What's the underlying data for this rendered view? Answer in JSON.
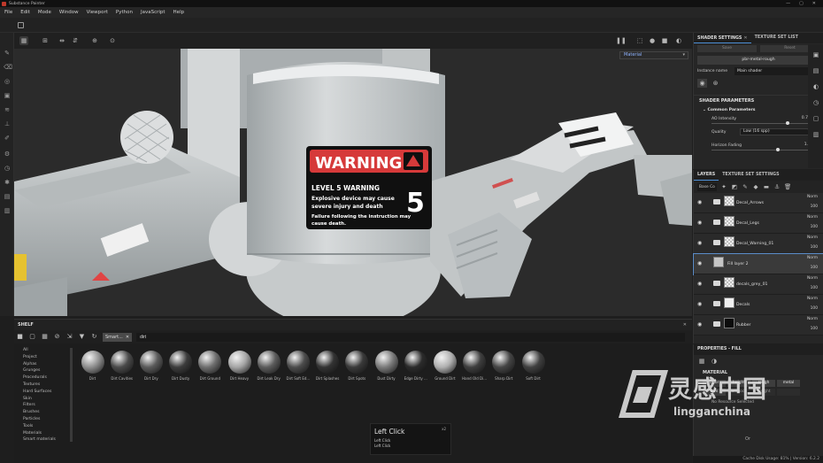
{
  "app": {
    "title": "Substance Painter",
    "window_controls": [
      "—",
      "▢",
      "✕"
    ]
  },
  "menu": [
    "File",
    "Edit",
    "Mode",
    "Window",
    "Viewport",
    "Python",
    "JavaScript",
    "Help"
  ],
  "viewport": {
    "material_select": "Material",
    "warning": {
      "header": "WARNING",
      "level": "LEVEL 5 WARNING",
      "line1": "Explosive device may cause",
      "line2": "severe injury and death",
      "line3": "Failure following the instruction may",
      "line4": "cause death.",
      "number": "5"
    }
  },
  "shelf": {
    "title": "SHELF",
    "tag_label": "Smart...",
    "tag_close": "✕",
    "search_value": "dirt",
    "categories": [
      "All",
      "Project",
      "Alphas",
      "Grunges",
      "Procedurals",
      "Textures",
      "Hard Surfaces",
      "Skin",
      "Filters",
      "Brushes",
      "Particles",
      "Tools",
      "Materials",
      "Smart materials"
    ],
    "items": [
      {
        "label": "Dirt",
        "color": "#8e8e8e"
      },
      {
        "label": "Dirt Cavities",
        "color": "#4a4a4a"
      },
      {
        "label": "Dirt Dry",
        "color": "#5a5a5a"
      },
      {
        "label": "Dirt Dusty",
        "color": "#3c3c3c"
      },
      {
        "label": "Dirt Ground",
        "color": "#6e6e6e"
      },
      {
        "label": "Dirt Heavy",
        "color": "#a5a5a5"
      },
      {
        "label": "Dirt Leak Dry",
        "color": "#5c5c5c"
      },
      {
        "label": "Dirt Soft Ed...",
        "color": "#4c4c4c"
      },
      {
        "label": "Dirt Splashes",
        "color": "#333333"
      },
      {
        "label": "Dirt Spots",
        "color": "#3a3a3a"
      },
      {
        "label": "Dust Dirty",
        "color": "#7a7a7a"
      },
      {
        "label": "Edge Dirty ...",
        "color": "#2b2b2b"
      },
      {
        "label": "Ground Dirt",
        "color": "#b0b0b0"
      },
      {
        "label": "Hand Old Di...",
        "color": "#3e3e3e"
      },
      {
        "label": "Sharp Dirt",
        "color": "#454545"
      },
      {
        "label": "Soft Dirt",
        "color": "#404040"
      }
    ]
  },
  "tooltip": {
    "title": "Left Click",
    "badge": "x2",
    "line1": "Left Click",
    "line2": "Left Click"
  },
  "shader_panel": {
    "tab_active": "SHADER SETTINGS",
    "tab_other": "TEXTURE SET LIST",
    "btn_left": "Save",
    "btn_right": "Reset",
    "shader_name": "pbr-metal-rough",
    "instance_label": "Instance name",
    "instance_value": "Main shader",
    "section": "SHADER PARAMETERS",
    "subsection": "Common Parameters",
    "ao_label": "AO Intensity",
    "ao_value": "0.75",
    "ao_level": 0.75,
    "quality_label": "Quality",
    "quality_value": "Low (16 spp)",
    "horizon_label": "Horizon Fading",
    "horizon_value": "1.3",
    "horizon_level": 0.65
  },
  "layers_panel": {
    "tab_active": "LAYERS",
    "tab_other": "TEXTURE SET SETTINGS",
    "blend_select": "Base Co",
    "rows": [
      {
        "name": "Decal_Arrows",
        "blend": "Norm",
        "opacity": "100",
        "thumb": "checker",
        "folder": true
      },
      {
        "name": "Decal_Legs",
        "blend": "Norm",
        "opacity": "100",
        "thumb": "checker",
        "folder": true
      },
      {
        "name": "Decal_Warning_01",
        "blend": "Norm",
        "opacity": "100",
        "thumb": "checker",
        "folder": true
      },
      {
        "name": "Fill layer 2",
        "blend": "Norm",
        "opacity": "100",
        "thumb": "fill",
        "folder": false
      },
      {
        "name": "decals_grey_01",
        "blend": "Norm",
        "opacity": "100",
        "thumb": "checker",
        "folder": true
      },
      {
        "name": "Decals",
        "blend": "Norm",
        "opacity": "100",
        "thumb": "white",
        "folder": true
      },
      {
        "name": "Rubber",
        "blend": "Norm",
        "opacity": "100",
        "thumb": "black",
        "folder": true
      }
    ]
  },
  "properties_panel": {
    "title": "PROPERTIES - FILL",
    "section": "MATERIAL",
    "channels": [
      {
        "label": "color",
        "on": true
      },
      {
        "label": "height",
        "on": true
      },
      {
        "label": "rough",
        "on": true
      },
      {
        "label": "metal",
        "on": true
      },
      {
        "label": "nrm",
        "on": true
      },
      {
        "label": "ambocc",
        "on": false
      },
      {
        "label": "delight",
        "on": false
      },
      {
        "label": "",
        "on": false
      }
    ],
    "note": "No Resource Selected",
    "or_text": "Or"
  },
  "status": {
    "text": "Cache Disk Usage: 81% | Version: 6.2.2"
  },
  "watermark": {
    "cn": "灵感中国",
    "url": "lingganchina"
  },
  "colors": {
    "accent": "#4d8fd6",
    "warning_red": "#d63a3a",
    "model_grey": "#bfc3c4"
  }
}
